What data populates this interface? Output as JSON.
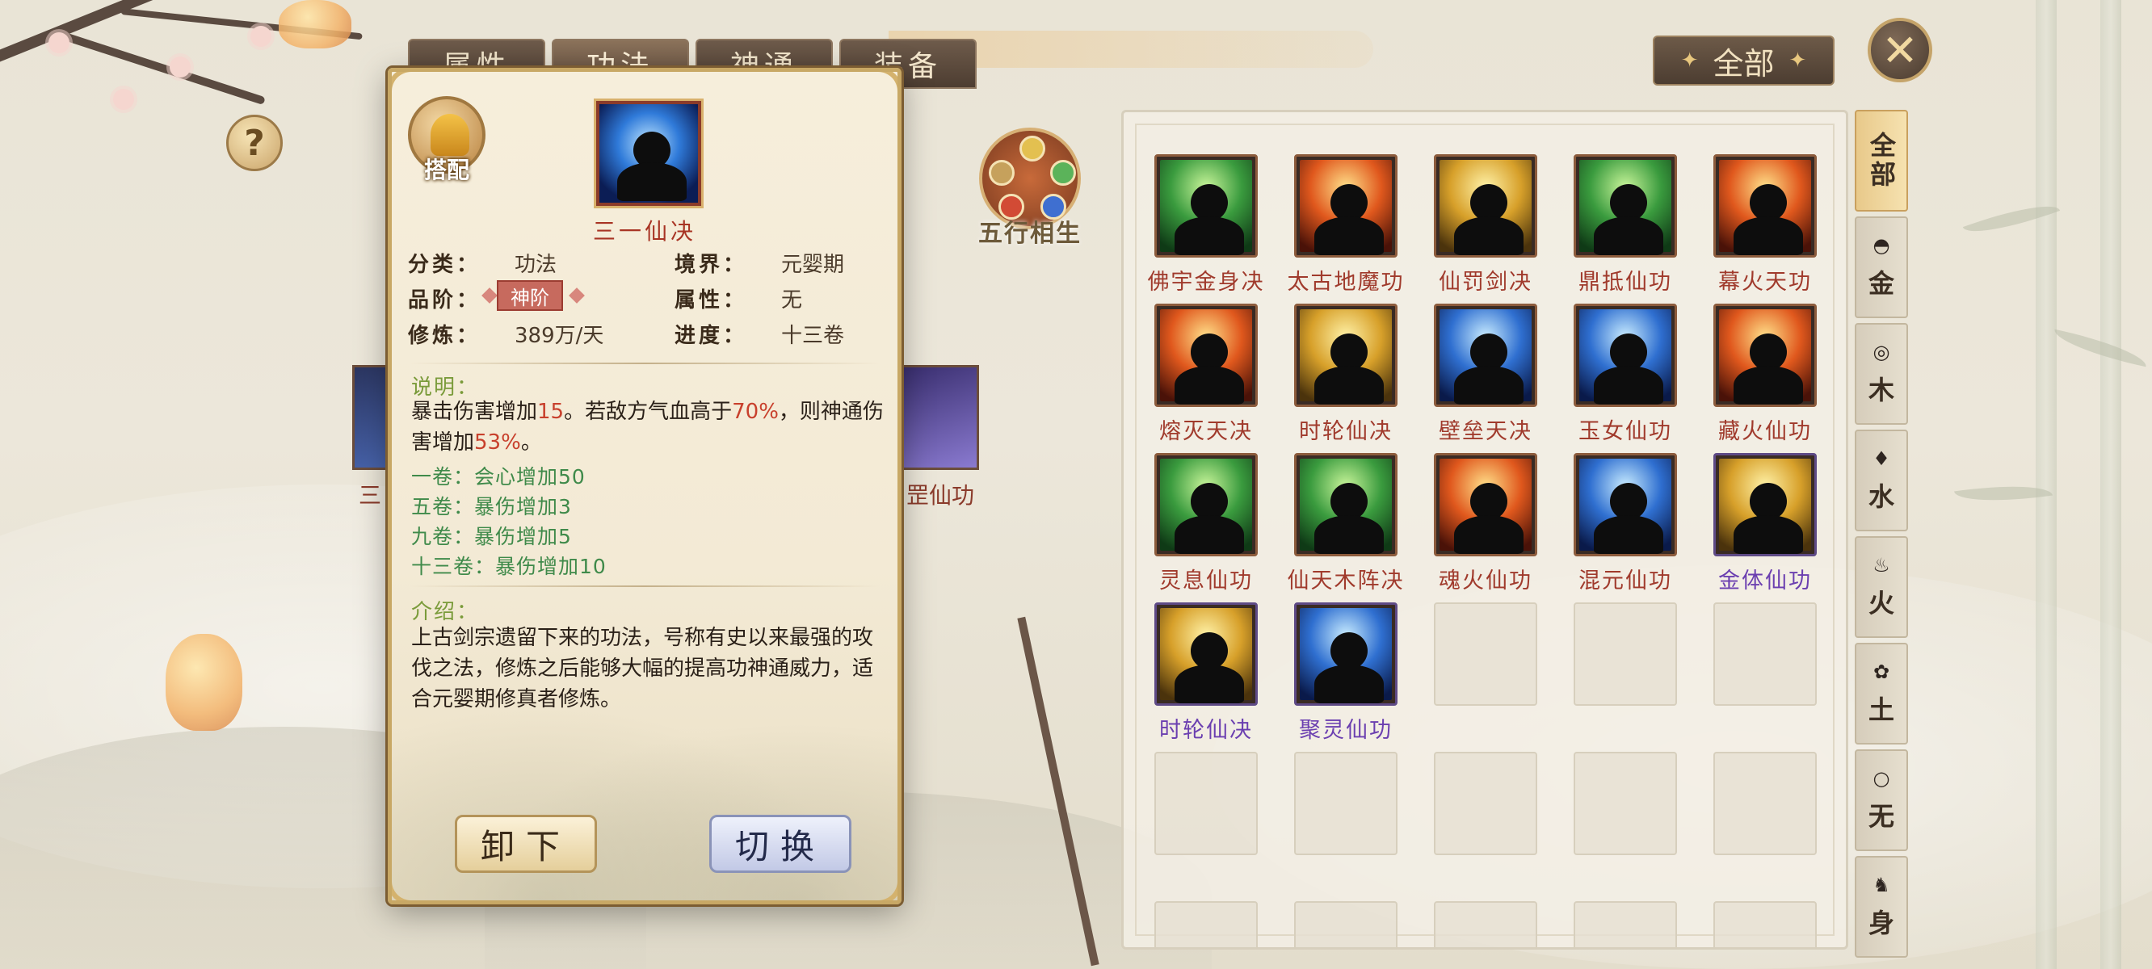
{
  "top_tabs": [
    "属性",
    "功法",
    "神通",
    "装备"
  ],
  "help_label": "?",
  "wuxing_label": "五行相生",
  "filter_label": "全部",
  "close_label": "✕",
  "element_tabs": [
    {
      "label": "全部",
      "icon": ""
    },
    {
      "label": "金",
      "icon": "◓"
    },
    {
      "label": "木",
      "icon": "◎"
    },
    {
      "label": "水",
      "icon": "♦"
    },
    {
      "label": "火",
      "icon": "♨"
    },
    {
      "label": "土",
      "icon": "✿"
    },
    {
      "label": "无",
      "icon": "○"
    },
    {
      "label": "身",
      "icon": "♞"
    }
  ],
  "grid_skills": [
    {
      "name": "佛宇金身决",
      "tone": "green",
      "rarity": "red"
    },
    {
      "name": "太古地魔功",
      "tone": "fire",
      "rarity": "red"
    },
    {
      "name": "仙罚剑决",
      "tone": "gold",
      "rarity": "red"
    },
    {
      "name": "鼎抵仙功",
      "tone": "green",
      "rarity": "red"
    },
    {
      "name": "幕火天功",
      "tone": "fire",
      "rarity": "red"
    },
    {
      "name": "熔灭天决",
      "tone": "fire",
      "rarity": "red"
    },
    {
      "name": "时轮仙决",
      "tone": "gold",
      "rarity": "red"
    },
    {
      "name": "壁垒天决",
      "tone": "blue",
      "rarity": "red"
    },
    {
      "name": "玉女仙功",
      "tone": "blue",
      "rarity": "red"
    },
    {
      "name": "藏火仙功",
      "tone": "fire",
      "rarity": "red"
    },
    {
      "name": "灵息仙功",
      "tone": "green",
      "rarity": "red"
    },
    {
      "name": "仙天木阵决",
      "tone": "green",
      "rarity": "red"
    },
    {
      "name": "魂火仙功",
      "tone": "fire",
      "rarity": "red"
    },
    {
      "name": "混元仙功",
      "tone": "blue",
      "rarity": "red"
    },
    {
      "name": "金体仙功",
      "tone": "gold",
      "rarity": "purple"
    },
    {
      "name": "时轮仙决",
      "tone": "gold",
      "rarity": "purple"
    },
    {
      "name": "聚灵仙功",
      "tone": "blue",
      "rarity": "purple"
    }
  ],
  "behind_text": {
    "left": "三",
    "right": "罡仙功"
  },
  "popup": {
    "equip_label": "搭配",
    "skill_name": "三一仙决",
    "attrs": {
      "category_key": "分类：",
      "category_val": "功法",
      "realm_key": "境界：",
      "realm_val": "元婴期",
      "grade_key": "品阶：",
      "grade_val": "神阶",
      "element_key": "属性：",
      "element_val": "无",
      "cultivate_key": "修炼：",
      "cultivate_val": "389万/天",
      "progress_key": "进度：",
      "progress_val": "十三卷"
    },
    "desc_head": "说明：",
    "desc_parts": [
      "暴击伤害增加",
      "15",
      "。若敌方气血高于",
      "70%",
      "，则神通伤害增加",
      "53%",
      "。"
    ],
    "volumes": [
      "一卷：会心增加50",
      "五卷：暴伤增加3",
      "九卷：暴伤增加5",
      "十三卷：暴伤增加10"
    ],
    "intro_head": "介绍：",
    "intro_text": "上古剑宗遗留下来的功法，号称有史以来最强的攻伐之法，修炼之后能够大幅的提高功神通威力，适合元婴期修真者修炼。",
    "btn_unload": "卸下",
    "btn_switch": "切换"
  },
  "colors": {
    "rarity_red": "#a03a2c",
    "rarity_purple": "#6b3fb0",
    "volume_green": "#3f8a4a",
    "highlight_num": "#c8402c"
  }
}
